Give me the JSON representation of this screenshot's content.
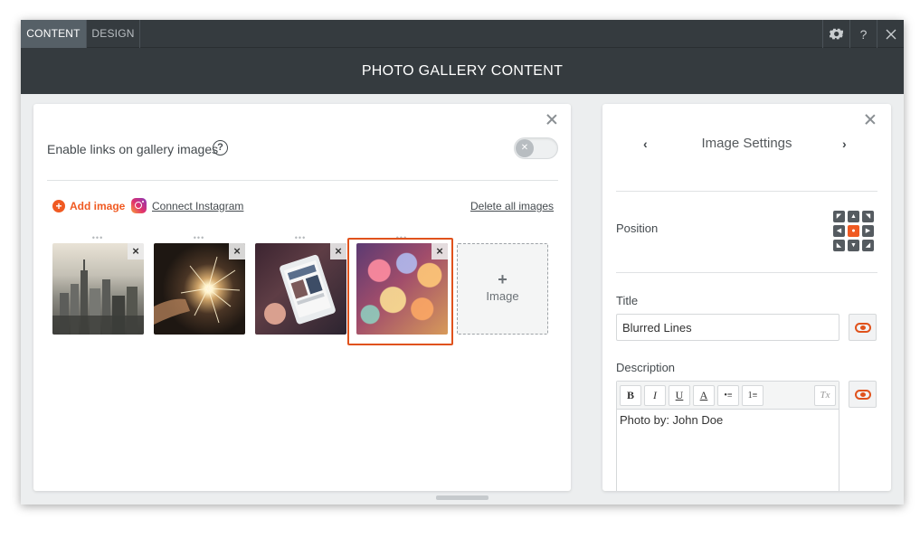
{
  "tabs": [
    {
      "label": "CONTENT",
      "active": true
    },
    {
      "label": "DESIGN",
      "active": false
    }
  ],
  "toolbar_icons": [
    "gear-icon",
    "help-icon",
    "close-icon"
  ],
  "toolbar_help_label": "?",
  "title": "PHOTO GALLERY CONTENT",
  "gallery": {
    "links_label": "Enable links on gallery images",
    "links_enabled": false,
    "help_label": "?",
    "add_image_label": "Add image",
    "connect_instagram_label": "Connect Instagram",
    "delete_all_label": "Delete all images",
    "images": [
      {
        "name": "city skyline",
        "selected": false
      },
      {
        "name": "sparkler",
        "selected": false
      },
      {
        "name": "tablet",
        "selected": false
      },
      {
        "name": "bokeh lights",
        "selected": true
      }
    ],
    "add_tile_plus": "+",
    "add_tile_label": "Image"
  },
  "image_settings": {
    "title": "Image Settings",
    "position_label": "Position",
    "position_selected": "center",
    "title_label": "Title",
    "title_value": "Blurred Lines",
    "description_label": "Description",
    "description_value": "Photo by: John Doe",
    "editor_buttons": [
      "B",
      "I",
      "U",
      "A",
      "•≡",
      "1≡",
      "Tx"
    ]
  },
  "colors": {
    "accent": "#f05a22",
    "header_bg": "#353b3f",
    "active_tab": "#566067"
  }
}
